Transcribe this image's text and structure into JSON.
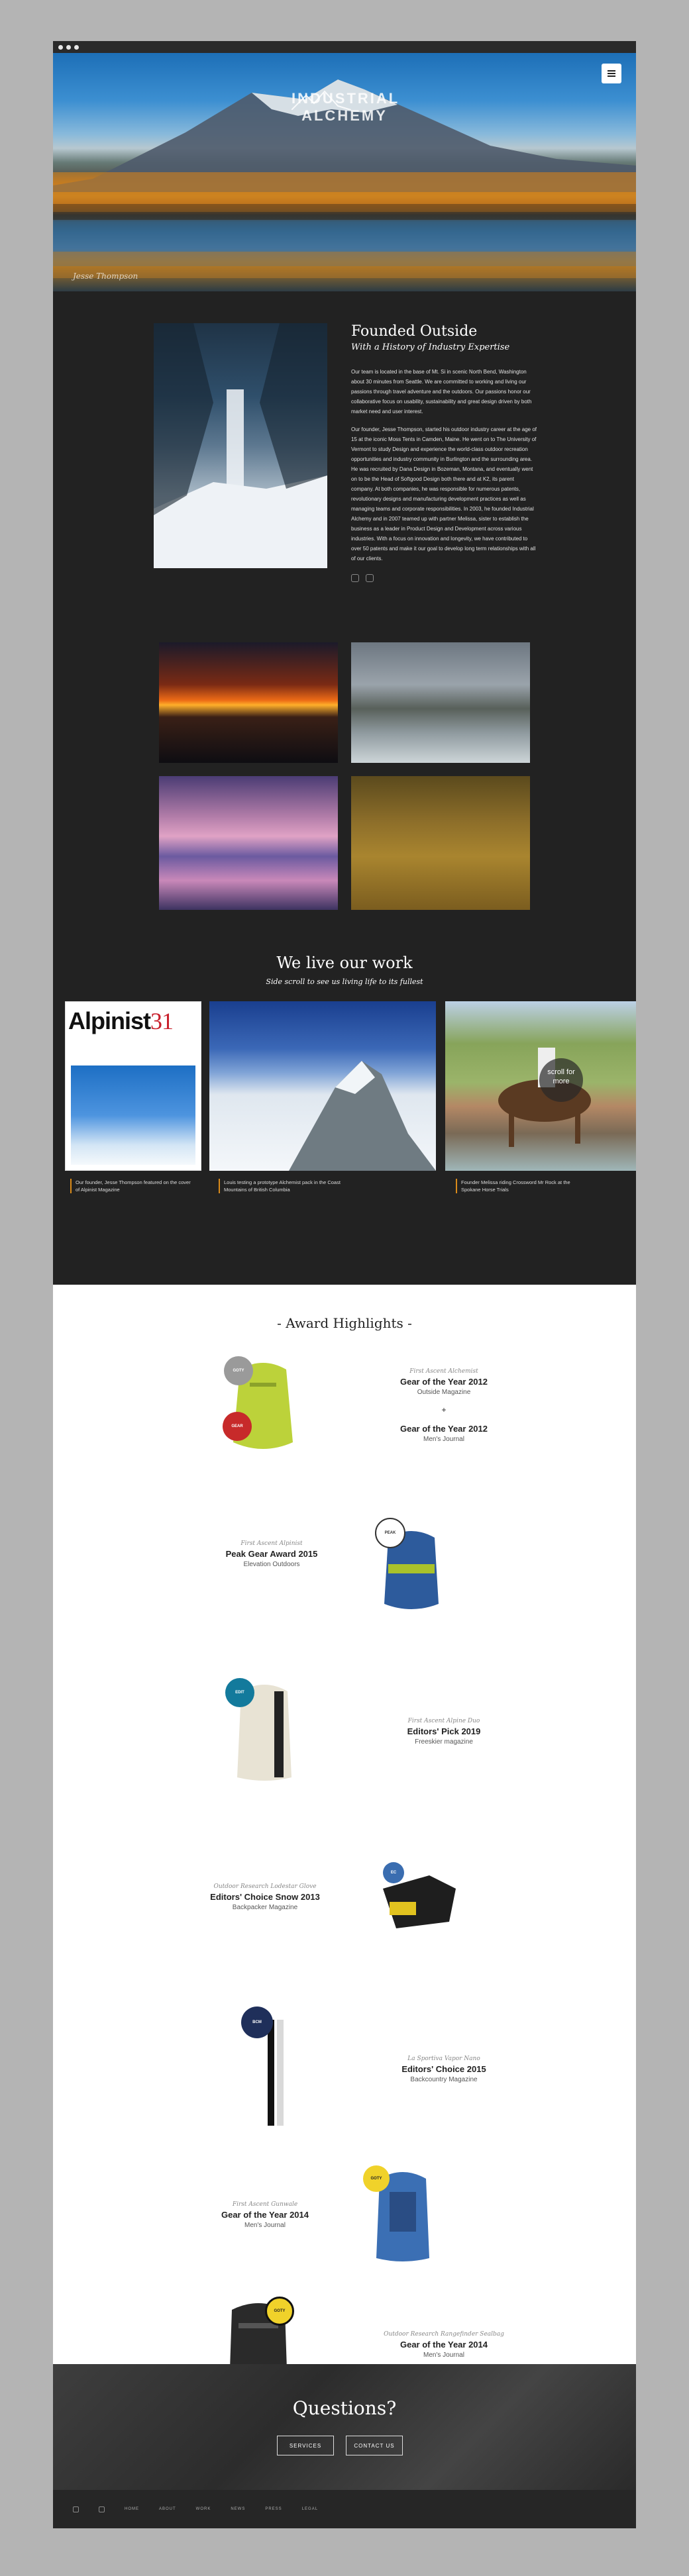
{
  "hero": {
    "logo_line1": "INDUSTRIAL",
    "logo_line2": "ALCHEMY",
    "signature": "Jesse Thompson"
  },
  "founded": {
    "title": "Founded Outside",
    "subtitle": "With a History of Industry Expertise",
    "para1": "Our team is located in the base of Mt. Si in scenic North Bend, Washington about 30 minutes from Seattle. We are committed to working and living our passions through travel adventure and the outdoors. Our passions honor our collaborative focus on usability, sustainability and great design driven by both market need and user interest.",
    "para2": "Our founder, Jesse Thompson, started his outdoor industry career at the age of 15 at the iconic Moss Tents in Camden, Maine. He went on to The University of Vermont to study Design and experience the world-class outdoor recreation opportunities and industry community in Burlington and the surrounding area. He was recruited by Dana Design in Bozeman, Montana, and eventually went on to be the Head of Softgood Design both there and at K2, its parent company. At both companies, he was responsible for numerous patents, revolutionary designs and manufacturing development practices as well as managing teams and corporate responsibilities. In 2003, he founded Industrial Alchemy and in 2007 teamed up with partner Melissa, sister to establish the business as a leader in Product Design and Development across various industries. With a focus on innovation and longevity, we have contributed to over 50 patents and make it our goal to develop long term relationships with all of our clients."
  },
  "work": {
    "title": "We live our work",
    "subtitle": "Side scroll to see us living life to its fullest",
    "magazine_title": "Alpinist",
    "magazine_issue": "31",
    "scroll_hint": "scroll for more",
    "captions": [
      "Our founder, Jesse Thompson featured on the cover of Alpinist Magazine",
      "Louis testing a prototype Alchemist pack in the Coast Mountains of British Columbia",
      "Founder Melissa riding Crossword Mr Rock at the Spokane Horse Trials"
    ]
  },
  "awards": {
    "title": "- Award Highlights -",
    "items": [
      {
        "maker": "First Ascent Alchemist",
        "name": "Gear of the Year 2012",
        "pub": "Outside Magazine",
        "name2": "Gear of the Year 2012",
        "pub2": "Men's Journal",
        "plus": "+"
      },
      {
        "maker": "First Ascent Alpinist",
        "name": "Peak Gear Award 2015",
        "pub": "Elevation Outdoors"
      },
      {
        "maker": "First Ascent Alpine Duo",
        "name": "Editors' Pick 2019",
        "pub": "Freeskier magazine"
      },
      {
        "maker": "Outdoor Research Lodestar Glove",
        "name": "Editors' Choice Snow 2013",
        "pub": "Backpacker Magazine"
      },
      {
        "maker": "La Sportiva Vapor Nano",
        "name": "Editors' Choice 2015",
        "pub": "Backcountry Magazine"
      },
      {
        "maker": "First Ascent Gunwale",
        "name": "Gear of the Year 2014",
        "pub": "Men's Journal"
      },
      {
        "maker": "Outdoor Research Rangefinder Sealbag",
        "name": "Gear of the Year 2014",
        "pub": "Men's Journal"
      }
    ]
  },
  "questions": {
    "title": "Questions?",
    "btn_services": "SERVICES",
    "btn_contact": "CONTACT US"
  },
  "footer": {
    "nav": [
      "HOME",
      "ABOUT",
      "WORK",
      "NEWS",
      "PRESS",
      "LEGAL"
    ]
  },
  "colors": {
    "accent": "#d98a1a",
    "dark_bg": "#222222",
    "frame_bg": "#b4b4b4"
  }
}
